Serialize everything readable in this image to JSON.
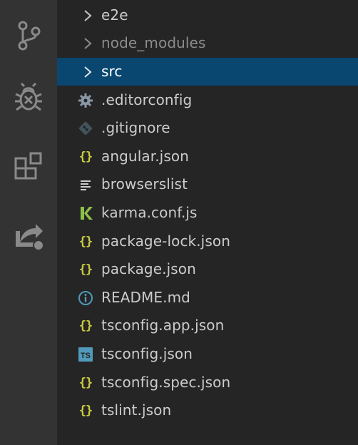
{
  "activity_bar": {
    "items": [
      {
        "icon": "source-control-icon"
      },
      {
        "icon": "debug-icon"
      },
      {
        "icon": "extensions-icon"
      },
      {
        "icon": "remote-explorer-icon"
      }
    ]
  },
  "explorer": {
    "folders": [
      {
        "label": "e2e",
        "icon": "chevron-right-icon"
      },
      {
        "label": "node_modules",
        "icon": "chevron-right-icon"
      },
      {
        "label": "src",
        "icon": "chevron-right-icon"
      }
    ],
    "files": [
      {
        "label": ".editorconfig",
        "icon": "gear-file-icon"
      },
      {
        "label": ".gitignore",
        "icon": "git-file-icon"
      },
      {
        "label": "angular.json",
        "icon": "json-file-icon"
      },
      {
        "label": "browserslist",
        "icon": "lines-file-icon"
      },
      {
        "label": "karma.conf.js",
        "icon": "karma-file-icon"
      },
      {
        "label": "package-lock.json",
        "icon": "json-file-icon"
      },
      {
        "label": "package.json",
        "icon": "json-file-icon"
      },
      {
        "label": "README.md",
        "icon": "info-file-icon"
      },
      {
        "label": "tsconfig.app.json",
        "icon": "json-file-icon"
      },
      {
        "label": "tsconfig.json",
        "icon": "typescript-file-icon"
      },
      {
        "label": "tsconfig.spec.json",
        "icon": "json-file-icon"
      },
      {
        "label": "tslint.json",
        "icon": "json-file-icon"
      }
    ],
    "json_glyph": "{}",
    "ts_glyph": "TS",
    "colors": {
      "selected_bg": "#094771",
      "json_icon": "#cbcb41",
      "karma_icon": "#8dc149",
      "info_icon": "#519aba",
      "ts_icon": "#519aba"
    }
  }
}
